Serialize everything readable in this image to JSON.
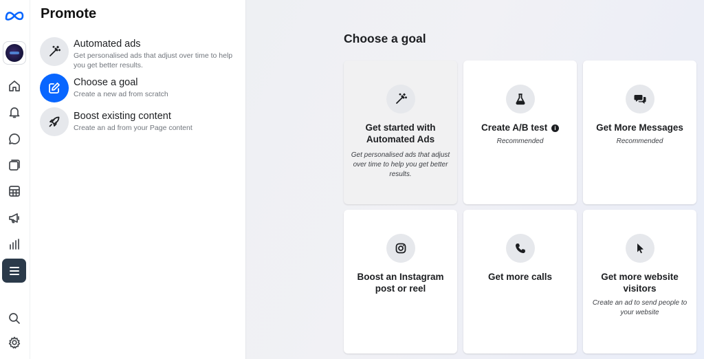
{
  "panel": {
    "title": "Promote",
    "options": [
      {
        "label": "Automated ads",
        "desc": "Get personalised ads that adjust over time to help you get better results."
      },
      {
        "label": "Choose a goal",
        "desc": "Create a new ad from scratch"
      },
      {
        "label": "Boost existing content",
        "desc": "Create an ad from your Page content"
      }
    ]
  },
  "main": {
    "heading": "Choose a goal",
    "cards": [
      {
        "title": "Get started with Automated Ads",
        "subtitle": "Get personalised ads that adjust over time to help you get better results.",
        "icon": "magic-wand-icon"
      },
      {
        "title": "Create A/B test",
        "info": "i",
        "subtitle": "Recommended",
        "icon": "flask-icon"
      },
      {
        "title": "Get More Messages",
        "subtitle": "Recommended",
        "icon": "chat-bubbles-icon"
      },
      {
        "title": "Boost an Instagram post or reel",
        "subtitle": "",
        "icon": "instagram-icon"
      },
      {
        "title": "Get more calls",
        "subtitle": "",
        "icon": "phone-icon"
      },
      {
        "title": "Get more website visitors",
        "subtitle": "Create an ad to send people to your website",
        "icon": "cursor-icon"
      }
    ]
  },
  "rail": {
    "icons": [
      "meta-logo-icon",
      "page-avatar",
      "home-icon",
      "bell-icon",
      "chat-icon",
      "content-icon",
      "planner-icon",
      "megaphone-icon",
      "insights-icon",
      "menu-icon",
      "search-icon",
      "settings-icon"
    ]
  },
  "colors": {
    "accent": "#0866ff",
    "rail_active": "#2b3a4a"
  }
}
